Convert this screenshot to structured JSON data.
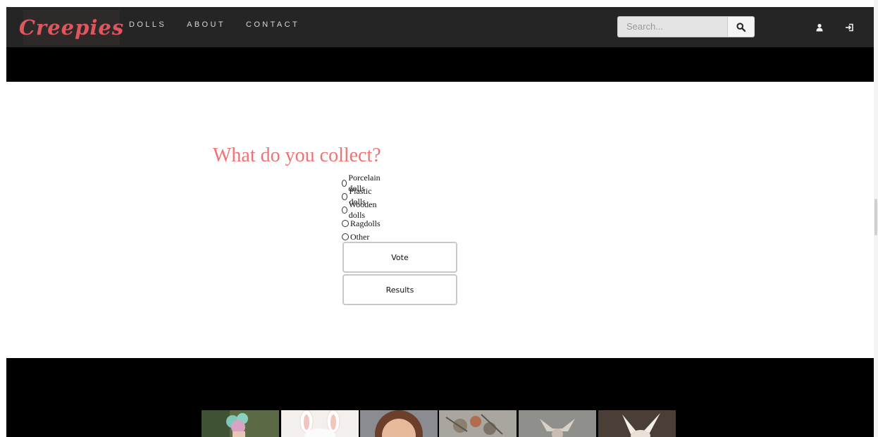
{
  "brand": {
    "logo_text": "Creepies",
    "logo_color": "#e0565e"
  },
  "nav": {
    "items": [
      {
        "label": "DOLLS"
      },
      {
        "label": "ABOUT"
      },
      {
        "label": "CONTACT"
      }
    ]
  },
  "search": {
    "placeholder": "Search..."
  },
  "poll": {
    "title": "What do you collect?",
    "title_color": "#f07272",
    "options": [
      {
        "label": "Porcelain dolls"
      },
      {
        "label": "Plastic dolls"
      },
      {
        "label": "Wooden dolls"
      },
      {
        "label": "Ragdolls"
      },
      {
        "label": "Other"
      }
    ],
    "vote_label": "Vote",
    "results_label": "Results"
  },
  "gallery": {
    "thumbnails": [
      {
        "icon": "doll-photo-green-hair"
      },
      {
        "icon": "doll-photo-white-rabbit"
      },
      {
        "icon": "doll-photo-girl-face"
      },
      {
        "icon": "doll-photo-rusty-gears"
      },
      {
        "icon": "doll-photo-horned-figure"
      },
      {
        "icon": "doll-photo-bat-ears"
      }
    ]
  }
}
